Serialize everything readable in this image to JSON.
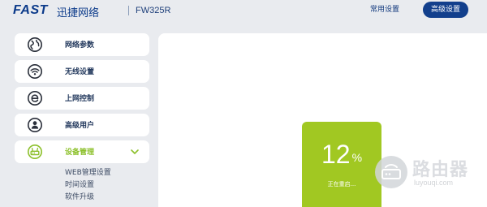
{
  "header": {
    "logo_brand": "FAST",
    "logo_cn": "迅捷网络",
    "model": "FW325R",
    "common_settings": "常用设置",
    "advanced_settings": "高级设置"
  },
  "sidebar": {
    "items": [
      {
        "label": "网络参数",
        "icon": "globe-icon"
      },
      {
        "label": "无线设置",
        "icon": "wifi-icon"
      },
      {
        "label": "上网控制",
        "icon": "e-icon"
      },
      {
        "label": "高级用户",
        "icon": "user-icon"
      },
      {
        "label": "设备管理",
        "icon": "router-icon",
        "active": true
      }
    ],
    "submenu": [
      "WEB管理设置",
      "时间设置",
      "软件升级"
    ]
  },
  "progress": {
    "value": "12",
    "unit": "%",
    "status": "正在重启..."
  },
  "watermark": {
    "main": "路由器",
    "sub": "luyouqi.com"
  },
  "colors": {
    "brand_blue": "#123f8c",
    "accent_green": "#8cc02a",
    "card_green": "#a1c822",
    "background": "#e9ebef"
  }
}
